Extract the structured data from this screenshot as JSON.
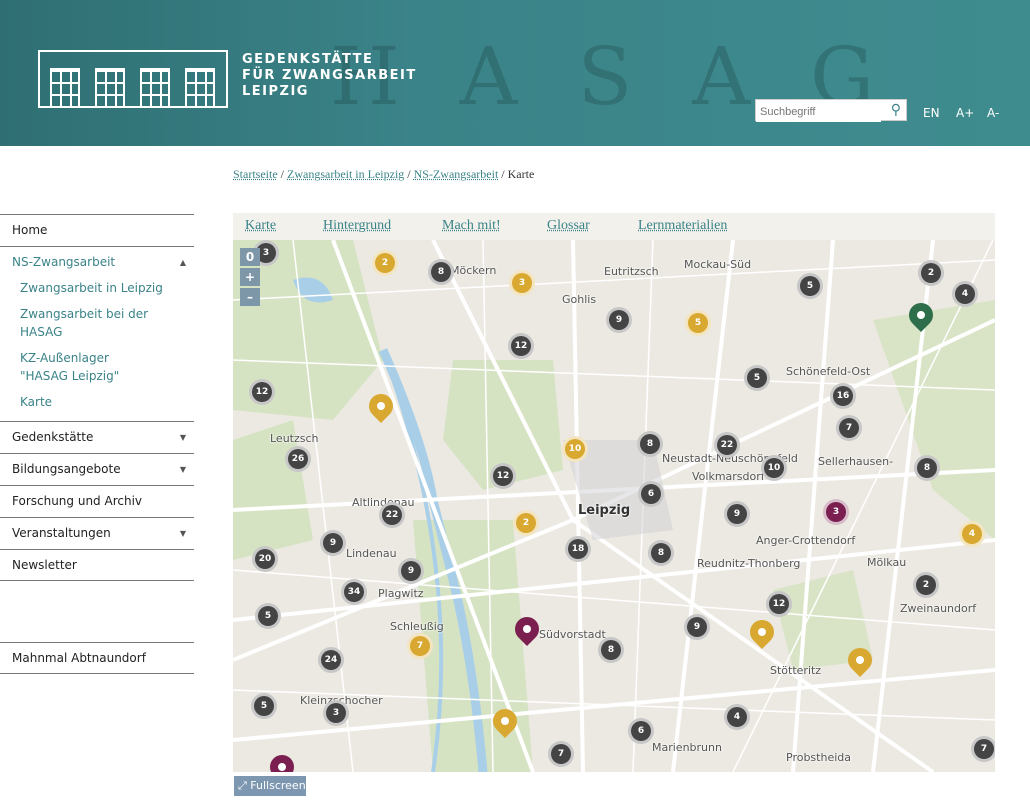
{
  "header": {
    "logo_lines": [
      "GEDENKSTÄTTE",
      "FÜR ZWANGSARBEIT",
      "LEIPZIG"
    ],
    "search_placeholder": "Suchbegriff",
    "lang": "EN",
    "font_plus": "A+",
    "font_minus": "A-"
  },
  "breadcrumb": {
    "items": [
      "Startseite",
      "Zwangsarbeit in Leipzig",
      "NS-Zwangsarbeit"
    ],
    "current": "Karte"
  },
  "sidebar": {
    "items": [
      {
        "label": "Home"
      },
      {
        "label": "NS-Zwangsarbeit",
        "caret": "▲"
      },
      {
        "label": "Gedenkstätte",
        "caret": "▼"
      },
      {
        "label": "Bildungsangebote",
        "caret": "▼"
      },
      {
        "label": "Forschung und Archiv"
      },
      {
        "label": "Veranstaltungen",
        "caret": "▼"
      },
      {
        "label": "Newsletter"
      }
    ],
    "subitems": [
      "Zwangsarbeit in Leipzig",
      "Zwangsarbeit bei der HASAG",
      "KZ-Außenlager \"HASAG Leipzig\"",
      "Karte"
    ],
    "extra": "Mahnmal Abtnaundorf"
  },
  "tabs": [
    "Karte",
    "Hintergrund",
    "Mach mit!",
    "Glossar",
    "Lernmaterialien"
  ],
  "map": {
    "zoom_level": "0",
    "zoom_in": "+",
    "zoom_out": "–",
    "fullscreen": "⤢ Fullscreen",
    "places": [
      "Möckern",
      "Eutritzsch",
      "Mockau-Süd",
      "Gohlis",
      "Schönefeld-Ost",
      "Leutzsch",
      "Neustadt-Neuschönefeld",
      "Volkmarsdorf",
      "Sellerhausen-",
      "Altlindenau",
      "Leipzig",
      "Anger-Crottendorf",
      "Lindenau",
      "Reudnitz-Thonberg",
      "Mölkau",
      "Plagwitz",
      "Zweinaundorf",
      "Schleußig",
      "Südvorstadt",
      "Stötteritz",
      "Kleinzschocher",
      "Probstheida",
      "Marienbrunn"
    ],
    "dark_clusters": [
      "3",
      "8",
      "2",
      "4",
      "5",
      "9",
      "12",
      "5",
      "16",
      "12",
      "7",
      "8",
      "22",
      "26",
      "10",
      "8",
      "12",
      "6",
      "22",
      "9",
      "9",
      "18",
      "8",
      "20",
      "9",
      "34",
      "2",
      "12",
      "5",
      "9",
      "8",
      "24",
      "5",
      "3",
      "4",
      "6",
      "7",
      "7"
    ],
    "yellow_clusters": [
      "2",
      "3",
      "5",
      "10",
      "2",
      "4",
      "7"
    ],
    "purple_clusters": [
      "3"
    ],
    "colors": {
      "dark": "#444444",
      "yellow": "#d9a830",
      "purple": "#7a1f4f",
      "green": "#2e6e4a"
    }
  }
}
